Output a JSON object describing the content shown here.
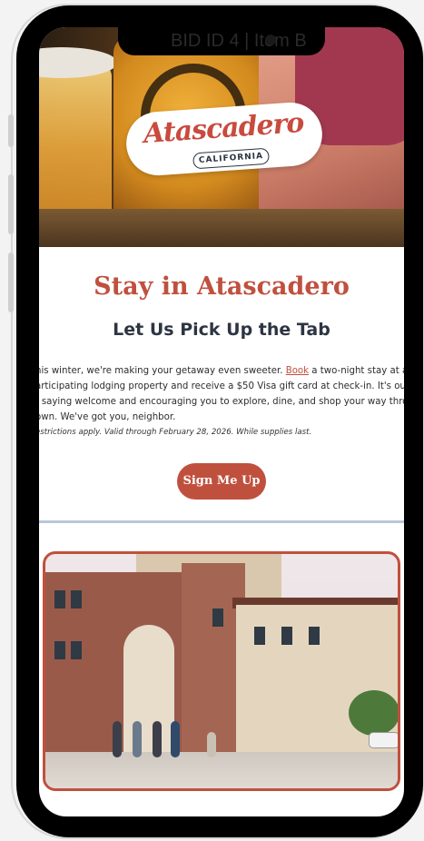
{
  "status_bar": {
    "text": "BID ID 4 | Item B"
  },
  "hero": {
    "logo_script": "Atascadero",
    "logo_sub": "CALIFORNIA"
  },
  "content": {
    "title": "Stay in Atascadero",
    "subtitle": "Let Us Pick Up the Tab",
    "body_line1_pre": "his winter, we're making your getaway even sweeter. ",
    "body_link": "Book",
    "body_line1_post": " a two-night stay at a",
    "body_line2": "articipating lodging property and receive a $50 Visa gift card at check-in. It's our way",
    "body_line3": "f saying welcome and encouraging you to explore, dine, and shop your way through",
    "body_line4": "own. We've got you, neighbor.",
    "fine_print": "estrictions apply. Valid through February 28, 2026. While supplies last.",
    "cta_label": "Sign Me Up"
  },
  "colors": {
    "accent": "#c0503e",
    "heading_dark": "#2d3542",
    "divider": "#b9c7dc"
  }
}
